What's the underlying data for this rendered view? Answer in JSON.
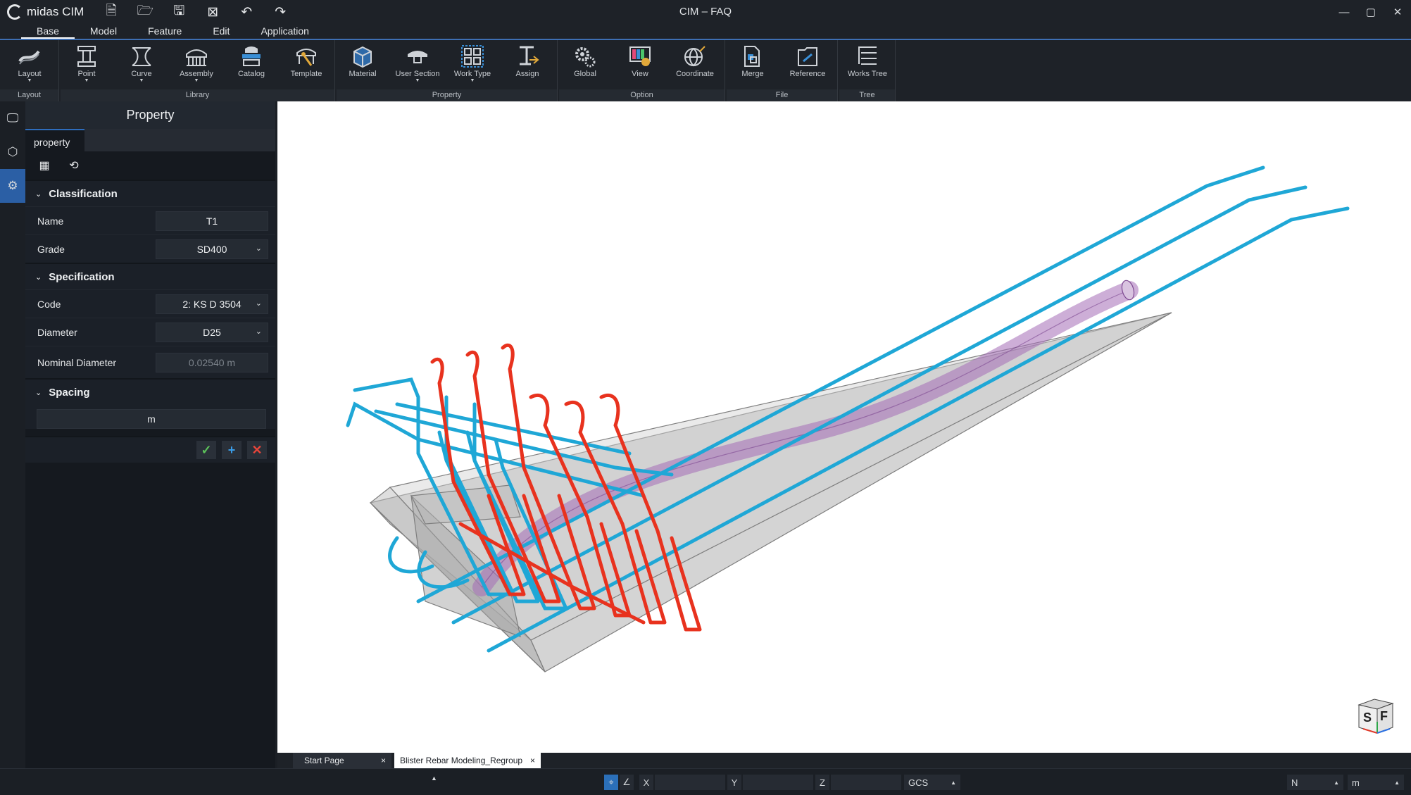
{
  "app": {
    "logo_text": "midas CIM",
    "window_title": "CIM – FAQ",
    "quick_access": [
      "new-file-icon",
      "open-folder-icon",
      "save-icon",
      "close-file-icon",
      "undo-icon",
      "redo-icon"
    ]
  },
  "menu": {
    "tabs": [
      "Base",
      "Model",
      "Feature",
      "Edit",
      "Application"
    ],
    "active": "Base"
  },
  "ribbon": {
    "groups": {
      "layout": "Layout",
      "library": "Library",
      "property": "Property",
      "option": "Option",
      "file": "File",
      "tree": "Tree"
    },
    "buttons": {
      "layout": "Layout",
      "point": "Point",
      "curve": "Curve",
      "assembly": "Assembly",
      "catalog": "Catalog",
      "template": "Template",
      "material": "Material",
      "user_section": "User Section",
      "work_type": "Work Type",
      "assign": "Assign",
      "global": "Global",
      "view": "View",
      "coordinate": "Coordinate",
      "merge": "Merge",
      "reference": "Reference",
      "works_tree": "Works Tree"
    }
  },
  "panel": {
    "title": "Property",
    "tab": "property",
    "classification": {
      "header": "Classification",
      "name_label": "Name",
      "name_value": "T1",
      "grade_label": "Grade",
      "grade_value": "SD400"
    },
    "specification": {
      "header": "Specification",
      "code_label": "Code",
      "code_value": "2: KS D 3504",
      "diameter_label": "Diameter",
      "diameter_value": "D25",
      "nominal_label": "Nominal Diameter",
      "nominal_value": "0.02540 m"
    },
    "spacing": {
      "header": "Spacing",
      "value": "m"
    }
  },
  "doc_tabs": [
    "Start Page",
    "Blister Rebar Modeling_Regroup"
  ],
  "status": {
    "x_label": "X",
    "y_label": "Y",
    "z_label": "Z",
    "coord_system": "GCS",
    "force_unit": "N",
    "length_unit": "m"
  },
  "navcube": {
    "left": "S",
    "right": "F"
  },
  "colors": {
    "accent": "#2e6dbd",
    "rebar_blue": "#1fa7d6",
    "rebar_red": "#e8321e",
    "duct": "#b07ac0",
    "concrete": "#a9a9a9"
  }
}
